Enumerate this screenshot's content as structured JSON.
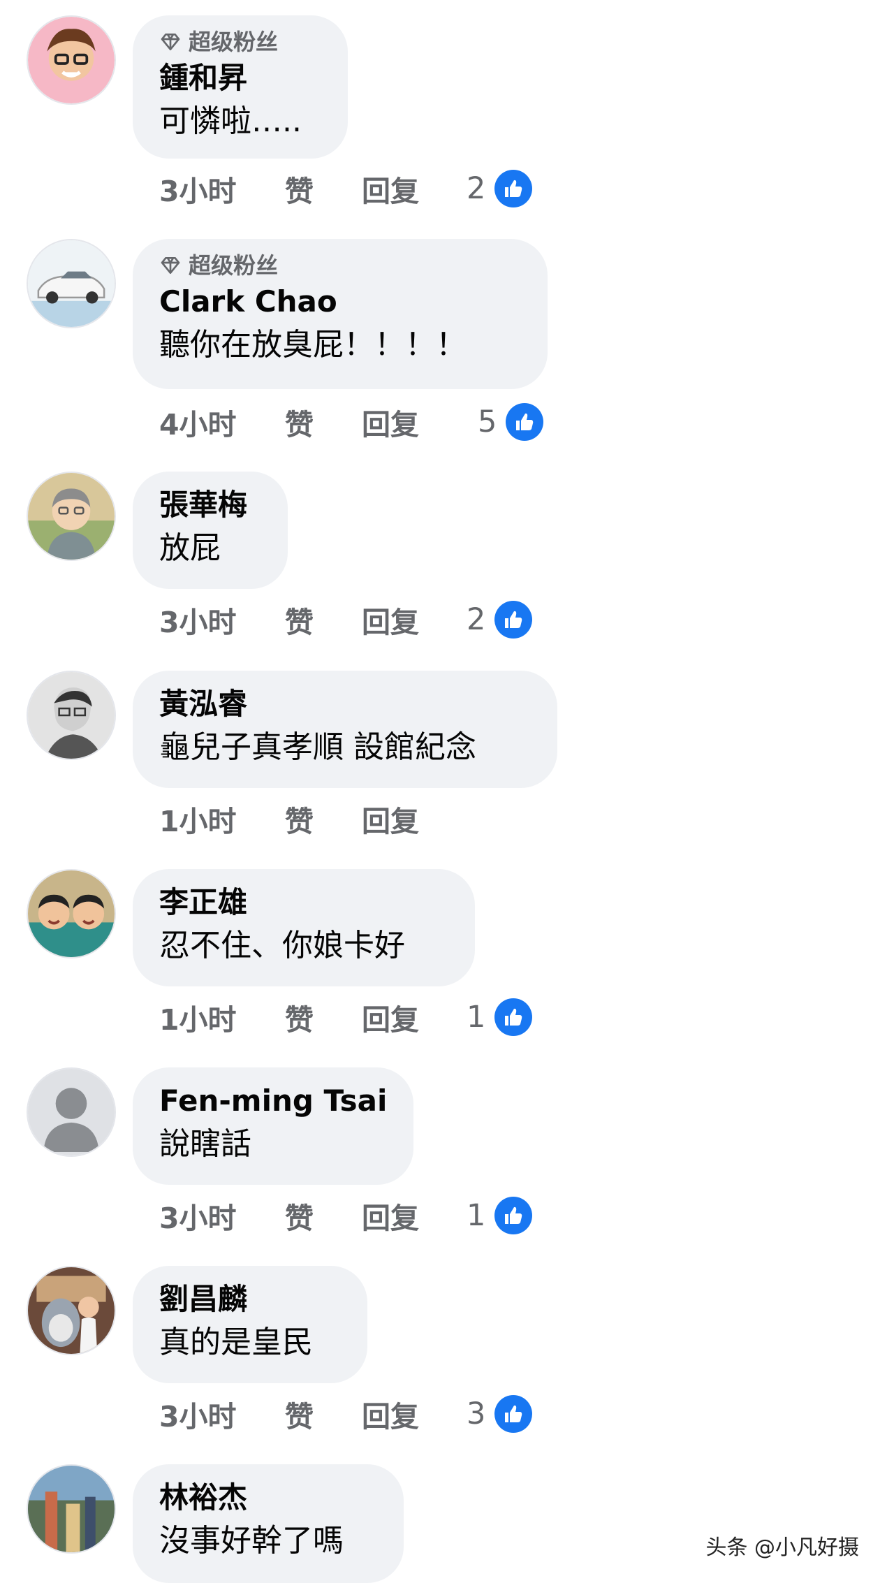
{
  "comments": [
    {
      "badge": "超级粉丝",
      "name": "鍾和昇",
      "text": "可憐啦…..",
      "time": "3小时",
      "like": "赞",
      "reply": "回复",
      "reactions": "2"
    },
    {
      "badge": "超级粉丝",
      "name": "Clark Chao",
      "text": "聽你在放臭屁！！！！",
      "time": "4小时",
      "like": "赞",
      "reply": "回复",
      "reactions": "5"
    },
    {
      "badge": "",
      "name": "張華梅",
      "text": "放屁",
      "time": "3小时",
      "like": "赞",
      "reply": "回复",
      "reactions": "2"
    },
    {
      "badge": "",
      "name": "黃泓睿",
      "text": "龜兒子真孝順 設館紀念",
      "time": "1小时",
      "like": "赞",
      "reply": "回复",
      "reactions": ""
    },
    {
      "badge": "",
      "name": "李正雄",
      "text": "忍不住、你娘卡好",
      "time": "1小时",
      "like": "赞",
      "reply": "回复",
      "reactions": "1"
    },
    {
      "badge": "",
      "name": "Fen-ming Tsai",
      "text": "說瞎話",
      "time": "3小时",
      "like": "赞",
      "reply": "回复",
      "reactions": "1"
    },
    {
      "badge": "",
      "name": "劉昌麟",
      "text": "真的是皇民",
      "time": "3小时",
      "like": "赞",
      "reply": "回复",
      "reactions": "3"
    },
    {
      "badge": "",
      "name": "林裕杰",
      "text": "沒事好幹了嗎",
      "time": "",
      "like": "",
      "reply": "",
      "reactions": ""
    }
  ],
  "icons": {
    "badge": "diamond-icon",
    "reaction": "thumbs-up-icon"
  },
  "colors": {
    "bubble": "#f0f2f5",
    "meta": "#65676b",
    "like_blue": "#1877f2"
  },
  "watermark": "头条 @小凡好摄"
}
